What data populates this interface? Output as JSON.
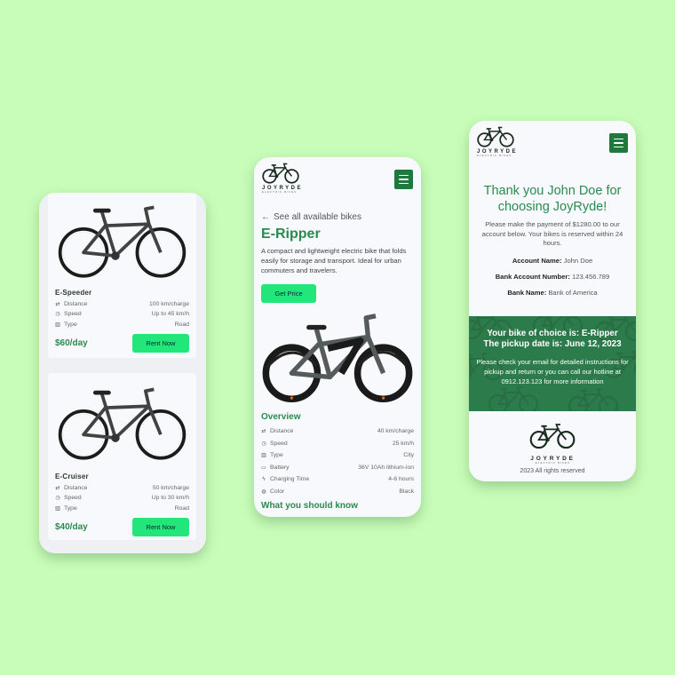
{
  "brand": {
    "name": "JOYRYDE",
    "tagline": "ELECTRIC BIKES",
    "colors": {
      "background": "#c8fdb9",
      "primary_green": "#2a8a4e",
      "dark_green": "#1e7a3c",
      "button_green": "#23e67a",
      "band_green": "#2c7c4b"
    }
  },
  "listing": {
    "bikes": [
      {
        "name": "E-Speeder",
        "specs": [
          {
            "icon": "distance-icon",
            "label": "Distance",
            "value": "100 km/charge"
          },
          {
            "icon": "speedometer-icon",
            "label": "Speed",
            "value": "Up to 45 km/h"
          },
          {
            "icon": "map-icon",
            "label": "Type",
            "value": "Road"
          }
        ],
        "price": "$60/day",
        "cta": "Rent Now"
      },
      {
        "name": "E-Cruiser",
        "specs": [
          {
            "icon": "distance-icon",
            "label": "Distance",
            "value": "50 km/charge"
          },
          {
            "icon": "speedometer-icon",
            "label": "Speed",
            "value": "Up to 30 km/h"
          },
          {
            "icon": "map-icon",
            "label": "Type",
            "value": "Road"
          }
        ],
        "price": "$40/day",
        "cta": "Rent Now"
      }
    ]
  },
  "detail": {
    "back_link": "See all available bikes",
    "title": "E-Ripper",
    "description": "A compact and lightweight electric bike that folds easily for storage and transport. Ideal for urban commuters and travelers.",
    "cta": "Get Price",
    "overview_title": "Overview",
    "overview": [
      {
        "icon": "distance-icon",
        "label": "Distance",
        "value": "40 km/charge"
      },
      {
        "icon": "speedometer-icon",
        "label": "Speed",
        "value": "25 km/h"
      },
      {
        "icon": "map-icon",
        "label": "Type",
        "value": "City"
      },
      {
        "icon": "battery-icon",
        "label": "Battery",
        "value": "36V 10Ah lithium-ion"
      },
      {
        "icon": "lightning-icon",
        "label": "Charging Time",
        "value": "4-6 hours"
      },
      {
        "icon": "palette-icon",
        "label": "Color",
        "value": "Black"
      }
    ],
    "know_title": "What you should know"
  },
  "confirmation": {
    "title": "Thank you John Doe for choosing JoyRyde!",
    "message": "Please make the payment of $1280.00 to our account below. Your bikes is reserved within 24 hours.",
    "account": [
      {
        "label": "Account Name:",
        "value": "John Doe"
      },
      {
        "label": "Bank Account Number:",
        "value": "123.456.789"
      },
      {
        "label": "Bank Name:",
        "value": "Bank of America"
      }
    ],
    "band": {
      "bike_line": "Your bike of choice is: E-Ripper",
      "date_line": "The pickup date is: June 12, 2023",
      "note": "Please check your email for detailed instructions for pickup and return or you can call our hotline at 0912.123.123 for more information"
    },
    "footer": "2023 All rights reserved"
  }
}
